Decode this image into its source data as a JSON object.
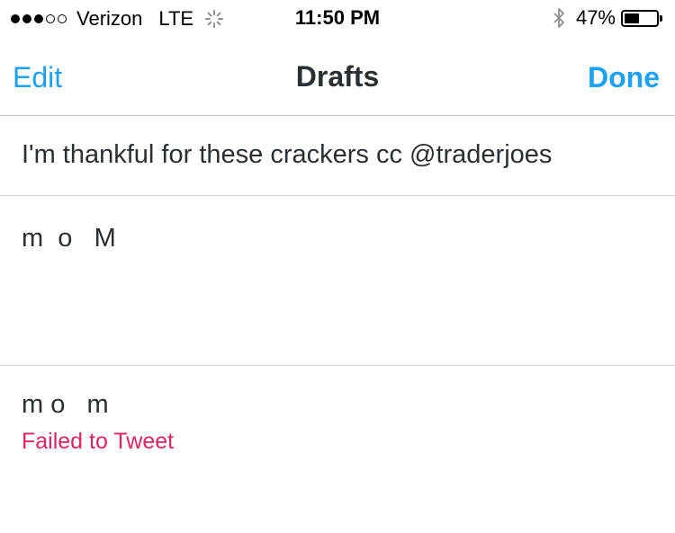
{
  "status_bar": {
    "carrier": "Verizon",
    "network": "LTE",
    "time": "11:50 PM",
    "battery_percent": "47%",
    "battery_level": 0.47,
    "signal_bars_filled": 3,
    "signal_bars_total": 5
  },
  "nav": {
    "edit_label": "Edit",
    "title": "Drafts",
    "done_label": "Done"
  },
  "drafts": [
    {
      "text": "I'm thankful for these crackers cc @traderjoes"
    },
    {
      "text": "m  o   M"
    },
    {
      "text": "m o   m",
      "status": "Failed to Tweet"
    }
  ],
  "colors": {
    "accent": "#1da1f2",
    "error": "#e0245e",
    "text": "#292f33"
  },
  "icons": [
    "signal-icon",
    "activity-spinner-icon",
    "bluetooth-icon",
    "battery-icon"
  ]
}
